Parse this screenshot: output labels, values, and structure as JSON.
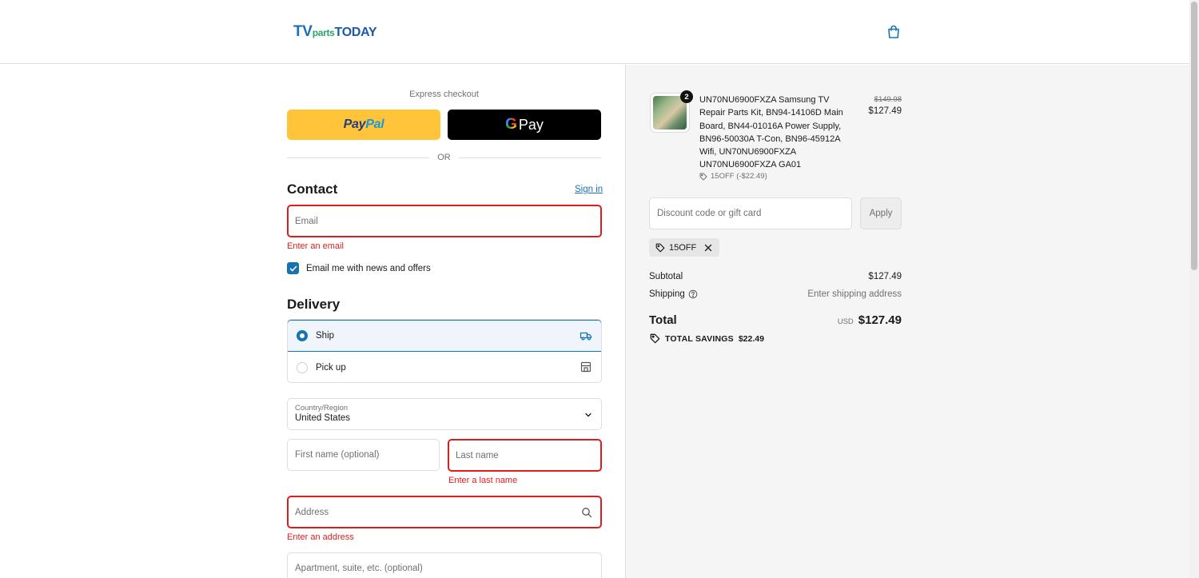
{
  "header": {
    "logo_tv": "TV",
    "logo_parts": "parts",
    "logo_today": "TODAY",
    "cart_icon": "shopping-bag-icon"
  },
  "express": {
    "label": "Express checkout",
    "paypal_part1": "Pay",
    "paypal_part2": "Pal",
    "gpay_g": "G",
    "gpay_label": "Pay",
    "or_label": "OR"
  },
  "contact": {
    "title": "Contact",
    "signin_label": "Sign in",
    "email_placeholder": "Email",
    "email_error": "Enter an email",
    "newsletter_label": "Email me with news and offers",
    "newsletter_checked": true
  },
  "delivery": {
    "title": "Delivery",
    "options": [
      {
        "label": "Ship",
        "selected": true,
        "icon": "truck-icon"
      },
      {
        "label": "Pick up",
        "selected": false,
        "icon": "store-icon"
      }
    ],
    "country_label": "Country/Region",
    "country_value": "United States",
    "first_name_placeholder": "First name (optional)",
    "last_name_placeholder": "Last name",
    "last_name_error": "Enter a last name",
    "address_placeholder": "Address",
    "address_error": "Enter an address",
    "apartment_placeholder": "Apartment, suite, etc. (optional)"
  },
  "summary": {
    "product": {
      "quantity": "2",
      "name": "UN70NU6900FXZA Samsung TV Repair Parts Kit, BN94-14106D Main Board, BN44-01016A Power Supply, BN96-50030A T-Con, BN96-45912A Wifi, UN70NU6900FXZA UN70NU6900FXZA GA01",
      "discount_line": "15OFF (-$22.49)",
      "price_original": "$149.98",
      "price_current": "$127.49"
    },
    "discount_placeholder": "Discount code or gift card",
    "apply_label": "Apply",
    "applied_code": "15OFF",
    "subtotal_label": "Subtotal",
    "subtotal_value": "$127.49",
    "shipping_label": "Shipping",
    "shipping_value": "Enter shipping address",
    "total_label": "Total",
    "total_currency": "USD",
    "total_value": "$127.49",
    "savings_label": "TOTAL SAVINGS",
    "savings_value": "$22.49"
  },
  "colors": {
    "accent": "#1773b0",
    "error": "#dd1d1d",
    "paypal_yellow": "#ffc439",
    "summary_bg": "#f5f5f5"
  }
}
